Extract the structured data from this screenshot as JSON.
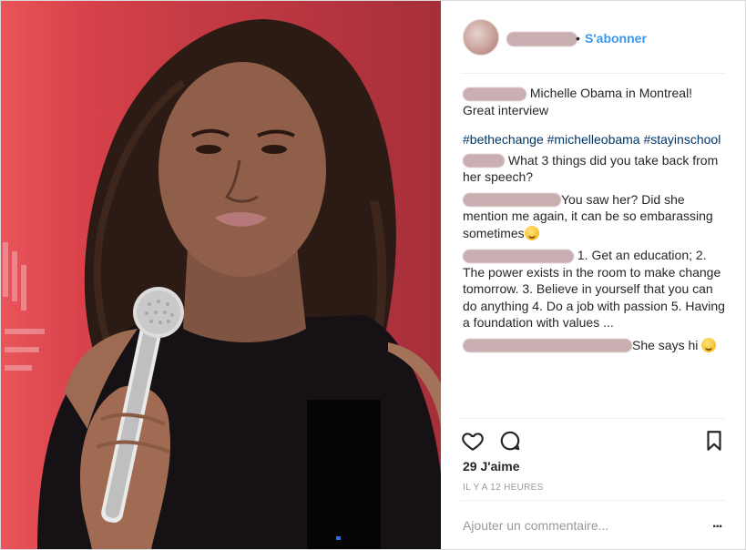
{
  "header": {
    "separator": "•",
    "follow_label": "S'abonner"
  },
  "post": {
    "caption": "Michelle Obama in Montreal! Great interview",
    "hashtags": "#bethechange #michelleobama #stayinschool"
  },
  "comments": [
    {
      "text": "What 3 things did you take back from her speech?"
    },
    {
      "text": "You saw her? Did she mention me again, it can be so embarassing sometimes",
      "emoji": "unamused-face"
    },
    {
      "prefix": "1.",
      "text": "Get an education; 2. The power exists in the room to make change tomorrow. 3. Believe in yourself that you can do anything 4. Do a job with passion 5. Having a foundation with values ..."
    },
    {
      "text": "She says hi",
      "emoji": "winking-tongue-face"
    }
  ],
  "actions": {
    "likes": "29 J'aime",
    "timestamp": "IL Y A 12 HEURES"
  },
  "add_comment": {
    "placeholder": "Ajouter un commentaire...",
    "more": "..."
  },
  "icons": [
    "heart-icon",
    "comment-icon",
    "bookmark-icon",
    "more-options-icon",
    "microphone"
  ],
  "colors": {
    "link": "#3897f0",
    "hashtag": "#003569",
    "backdrop": "#c73c44"
  }
}
